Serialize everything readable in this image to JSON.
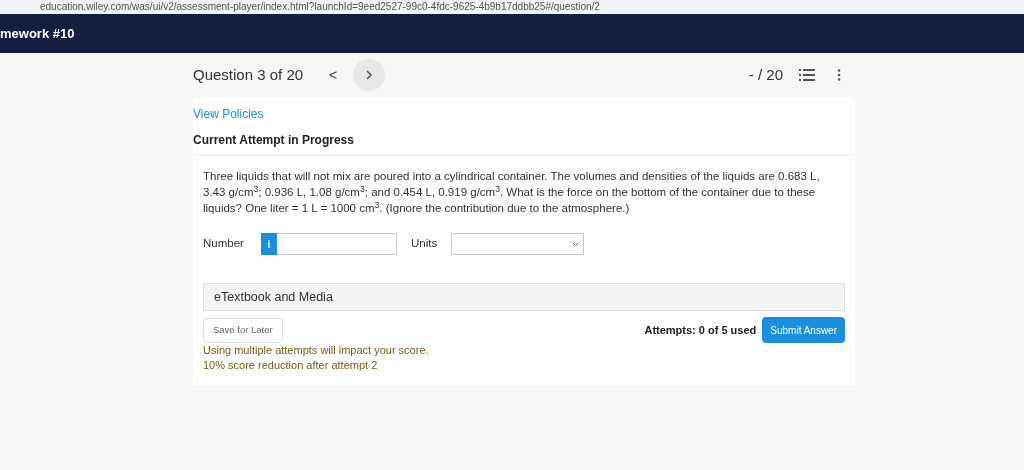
{
  "browser": {
    "url": "education.wiley.com/was/ui/v2/assessment-player/index.html?launchId=9eed2527-99c0-4fdc-9625-4b9b17ddbb25#/question/2"
  },
  "header": {
    "title": "mework #10"
  },
  "nav": {
    "question": "Question 3 of 20",
    "prev": "<",
    "score": "- / 20"
  },
  "card": {
    "policies_link": "View Policies",
    "attempt_heading": "Current Attempt in Progress",
    "question_text": "Three liquids that will not mix are poured into a cylindrical container. The volumes and densities of the liquids are 0.683 L, 3.43 g/cm$^{3}$; 0.936 L, 1.08 g/cm$^{3}$; and 0.454 L, 0.919 g/cm$^{3}$. What is the force on the bottom of the container due to these liquids? One liter = 1 L = 1000 cm$^{3}$. (Ignore the contribution due to the atmosphere.)",
    "number_label": "Number",
    "info_badge": "i",
    "units_label": "Units",
    "media_panel": "eTextbook and Media",
    "save_button": "Save for Later",
    "attempts": "Attempts: 0 of 5 used",
    "submit_button": "Submit Answer",
    "notes": [
      "Using multiple attempts will impact your score.",
      "10% score reduction after attempt 2"
    ]
  }
}
